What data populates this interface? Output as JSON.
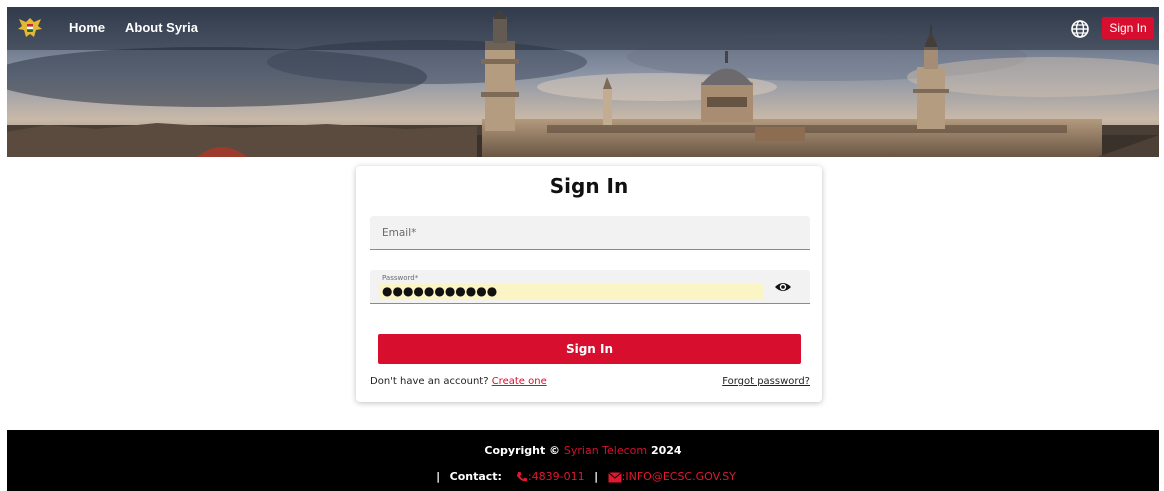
{
  "nav": {
    "home": "Home",
    "about": "About Syria",
    "signin": "Sign In",
    "logo_icon": "syrian-eagle-emblem",
    "language_icon": "globe-icon"
  },
  "form": {
    "title": "Sign In",
    "email_label": "Email*",
    "password_label": "Password*",
    "password_value": "●●●●●●●●●●●",
    "submit": "Sign In",
    "no_account": "Don't have an account?",
    "create": "Create one",
    "forgot": "Forgot password?"
  },
  "footer": {
    "copyright_prefix": "Copyright ©",
    "brand": "Syrian Telecom",
    "year": "2024",
    "contact_label": "Contact:",
    "phone": ":4839-011",
    "email": ":INFO@ECSC.GOV.SY",
    "separator": "|"
  },
  "colors": {
    "accent": "#d70e2e",
    "footer_bg": "#000000"
  }
}
